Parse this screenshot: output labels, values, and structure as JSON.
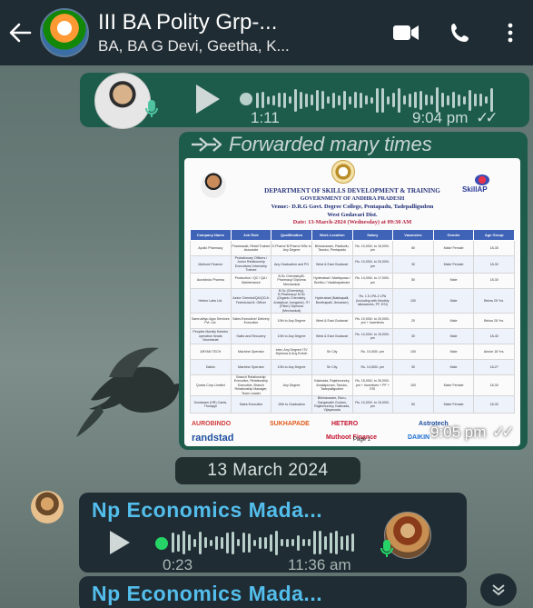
{
  "header": {
    "back_icon": "arrow-left-icon",
    "title": "III BA Polity Grp-...",
    "subtitle": "BA, BA G Devi, Geetha, K...",
    "video_icon": "video-call-icon",
    "call_icon": "phone-icon",
    "menu_icon": "more-vertical-icon"
  },
  "voice_message_1": {
    "duration": "1:11",
    "time": "9:04 pm",
    "status": "✓✓"
  },
  "image_message": {
    "forwarded_label": "Forwarded many times",
    "time": "9:05 pm",
    "status": "✓✓",
    "poster": {
      "department": "DEPARTMENT OF SKILLS DEVELOPMENT & TRAINING",
      "government": "GOVERNMENT OF ANDHRA PRADESH",
      "venue": "Venue:- D.R.G Govt. Degree College, Pentapadu, Tadepalligudem",
      "district": "West Godavari Dist.",
      "date": "Date: 13-March-2024 (Wednesday) at 09:30 AM",
      "brand": "SkillAP",
      "columns": [
        "Company Name",
        "Job Role",
        "Qualification",
        "Work Location",
        "Salary",
        "Vacancies",
        "Gender",
        "Age Group"
      ],
      "rows": [
        [
          "Apollo Pharmacy",
          "Pharmacist, Retail Trainee Associate",
          "D.Pharm/ B.Pharm/ MSc in Any Degree",
          "Bhimavaram, Palakollu, Tanuku, Pentapadu",
          "Rs. 10,000/- to 16,000/- pm",
          "50",
          "Male/ Female",
          "18-35"
        ],
        [
          "Muthoot Finance",
          "Probationary Officers / Junior Relationship Executives/ Internship Trainee",
          "Any Graduation and PG",
          "West & East Godavari",
          "Rs. 10,000/- to 20,000/- pm",
          "30",
          "Male/ Female",
          "18-30"
        ],
        [
          "Aurobindo Pharma",
          "Production / QC / QA / Maintenance",
          "B.Sc Chemistry/B. Pharmacy/ Diploma Mechanical",
          "Hyderabad / Mahbpurao / Bonthu / Visakhapatnam",
          "Rs. 14,000/- to 17,000/- pm",
          "50",
          "Male",
          "18-30"
        ],
        [
          "Hetero Labs Ltd.",
          "Junior Chemist/QA/QC/Jr. Technician/Jr. Officer",
          "B.Sc (Chemistry), B.Pharmacy/ M.Sc (Organic Chemistry, Analytical, Inorganic), ITI (Fitter)/ Diploma (Mechanical)",
          "Hyderabad (Nakkapalli, Bonthapalli, Jinnaram)",
          "Rs. 1.5 LPA-2 LPA (Including with Monthly allowances, PF, ESI)",
          "100",
          "Male",
          "Below 25 Yrs."
        ],
        [
          "Samrudhyu Agro Services Pvt. Ltd.",
          "Sales Executive/ Delivery Executive",
          "10th to Any Degree",
          "West & East Godavari",
          "Rs. 10,000/- to 20,000/- pm + Incentives",
          "20",
          "Male",
          "Below 28 Yrs."
        ],
        [
          "Peoples Morally Kshetro operation heads Secretariat",
          "Sales and Recovery",
          "10th to Any Degree",
          "West & East Godavari",
          "Rs. 10,000/- to 15,000/- pm",
          "30",
          "Male",
          "18-40"
        ],
        [
          "ARYAN TECH",
          "Machine Operator",
          "Inter, Any Degree/ ITI/ Diploma & Any B.tech",
          "Sri City",
          "Rs. 10,000/- pm",
          "100",
          "Male",
          "Above 18 Yrs."
        ],
        [
          "Daikin",
          "Machine Operator",
          "10th to Any Degree",
          "Sri City",
          "Rs. 14,500/- pm",
          "30",
          "Male",
          "18-27"
        ],
        [
          "Quess Corp Limited",
          "Branch Relationship Executive, Relationship Executive, Branch Relationship Manager, Team Leader",
          "Any Degree",
          "Kakinada, Rajahmundry, Amalapuram, Tanuku, Tadepalligudem",
          "Rs. 15,000/- to 30,000/- pm + Incentives + PF + ESI",
          "100",
          "Male/ Female",
          "18-30"
        ],
        [
          "Sundaram (HR) Cards, Thorappi",
          "Sales Executive",
          "10th to Graduation",
          "Bhimavaram, Eluru, Gangavathi Godam, Rajahmundry, Kakinada, Vijayawada",
          "Rs. 10,000/- to 15,000/- pm",
          "50",
          "Male/ Female",
          "18-30"
        ]
      ],
      "logos": [
        "AUROBINDO",
        "SUKHAPADE",
        "HETERO",
        "Astrotech",
        "randstad",
        "Muthoot Finance",
        "DAIKIN"
      ],
      "page_label": "Page 1"
    }
  },
  "date_separator": "13 March 2024",
  "incoming_1": {
    "sender": "Np Economics Mada...",
    "duration": "0:23",
    "time": "11:36 am"
  },
  "incoming_2": {
    "sender": "Np Economics Mada..."
  },
  "colors": {
    "header_bg": "#1f2c33",
    "outgoing_bubble": "#1d5c4a",
    "incoming_bubble": "#1f2c33",
    "sender_name": "#53bdeb",
    "voice_dot": "#25d366"
  }
}
